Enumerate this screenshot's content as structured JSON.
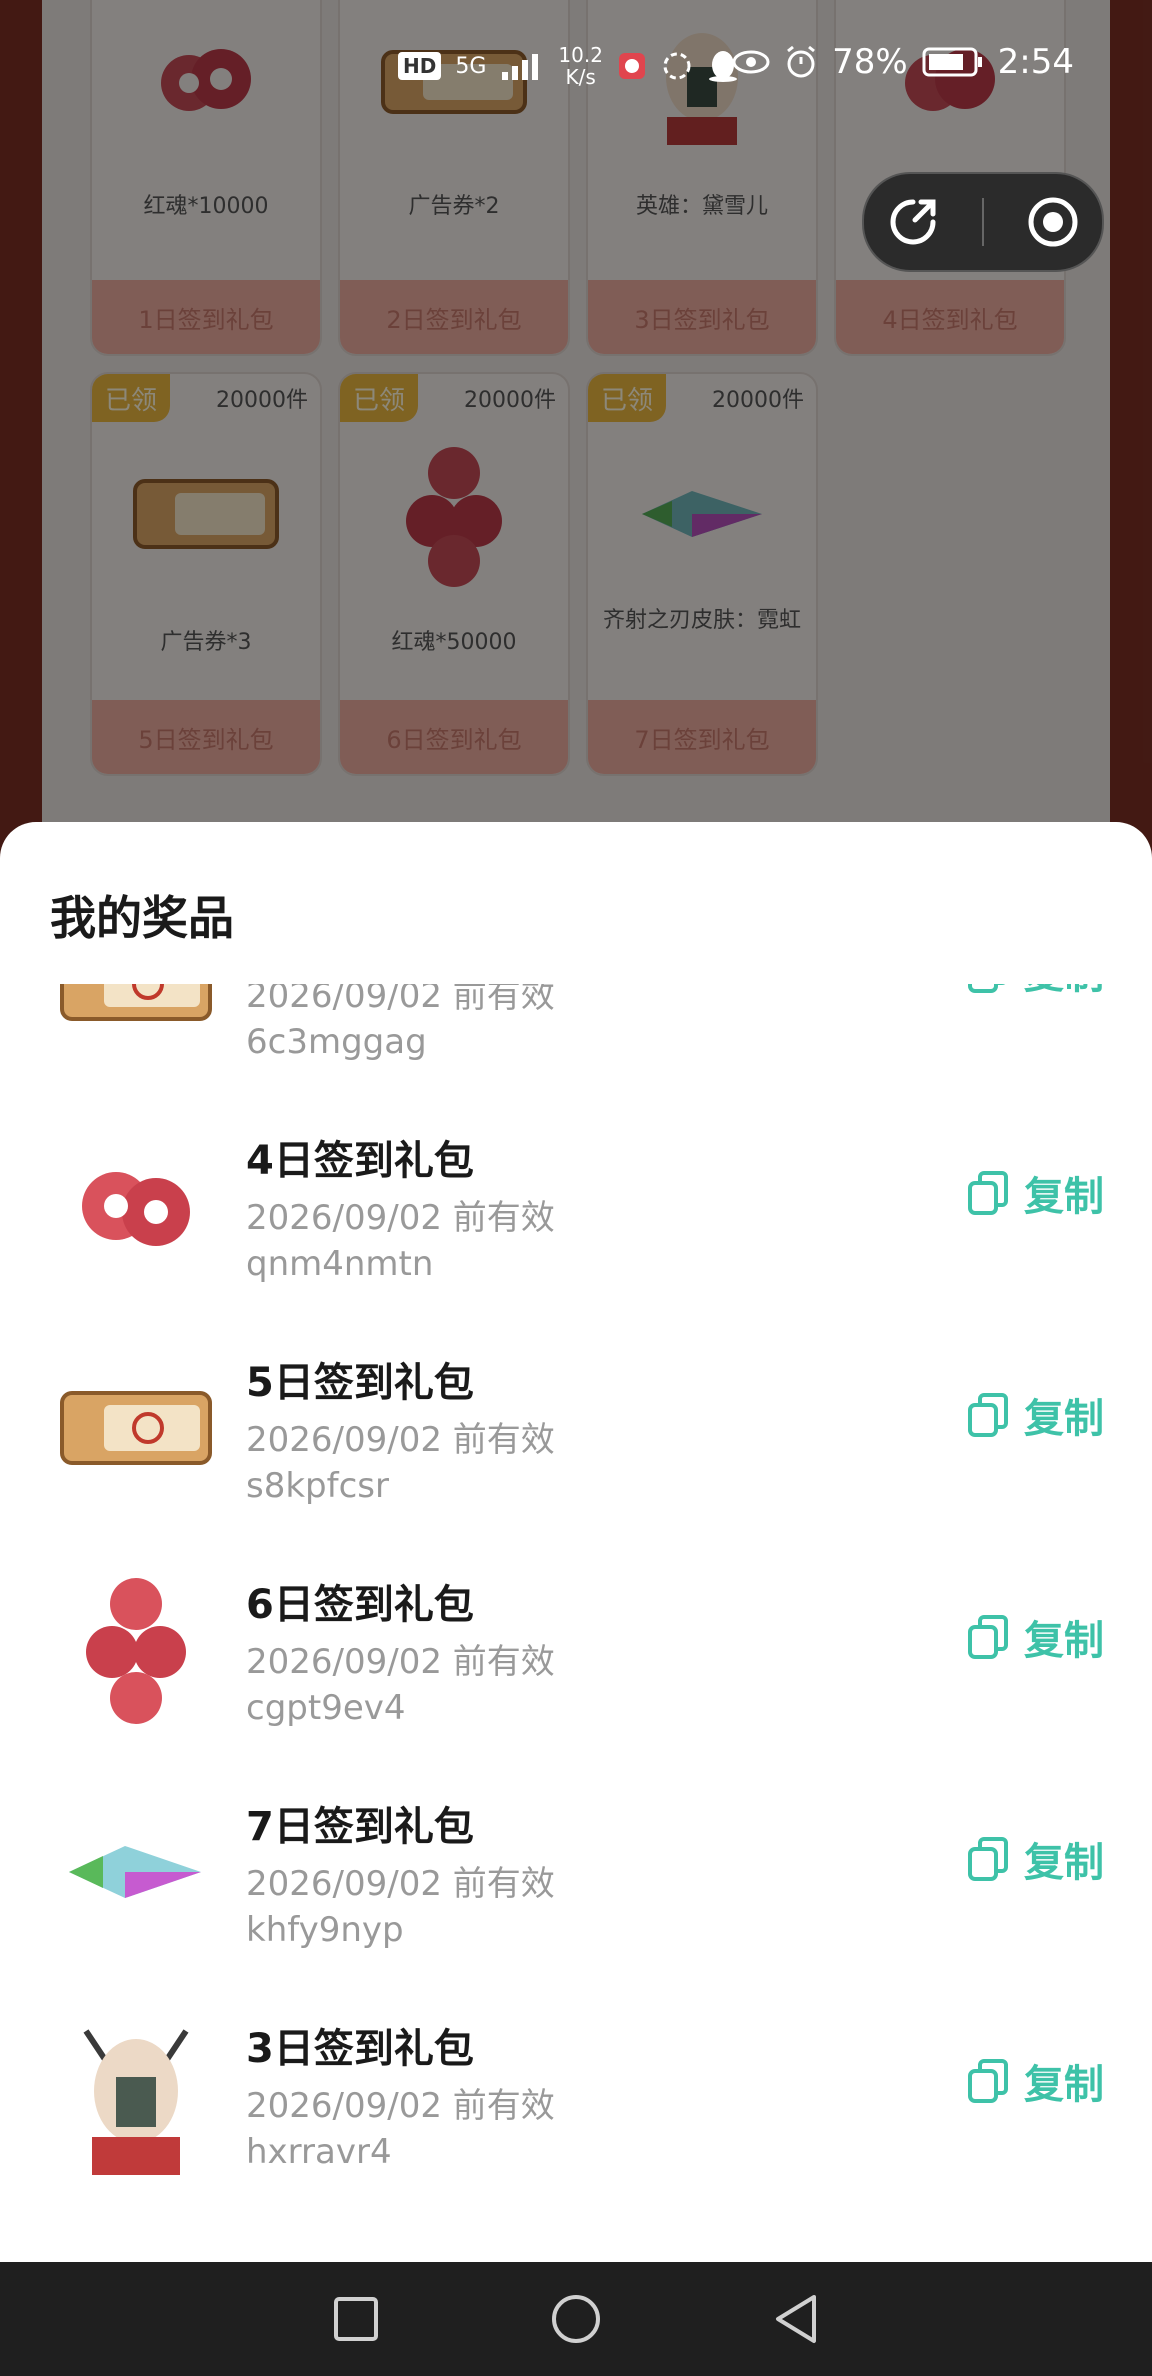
{
  "status_bar": {
    "hd": "HD",
    "network": "5G",
    "speed_value": "10.2",
    "speed_unit": "K/s",
    "battery": "78%",
    "time": "2:54"
  },
  "background_cards": [
    {
      "name": "红魂*10000",
      "footer": "1日签到礼包"
    },
    {
      "name": "广告券*2",
      "footer": "2日签到礼包"
    },
    {
      "name": "英雄：黛雪儿",
      "footer": "3日签到礼包"
    },
    {
      "name": "",
      "footer": "4日签到礼包"
    },
    {
      "badge": "已领",
      "count": "20000件",
      "name": "广告券*3",
      "footer": "5日签到礼包"
    },
    {
      "badge": "已领",
      "count": "20000件",
      "name": "红魂*50000",
      "footer": "6日签到礼包"
    },
    {
      "badge": "已领",
      "count": "20000件",
      "name": "齐射之刃皮肤：霓虹",
      "footer": "7日签到礼包"
    }
  ],
  "sheet": {
    "title": "我的奖品",
    "copy_label": "复制",
    "items": [
      {
        "title": "",
        "expiry": "2026/09/02 前有效",
        "code": "6c3mggag",
        "icon": "ticket-icon"
      },
      {
        "title": "4日签到礼包",
        "expiry": "2026/09/02 前有效",
        "code": "qnm4nmtn",
        "icon": "red-soul-icon"
      },
      {
        "title": "5日签到礼包",
        "expiry": "2026/09/02 前有效",
        "code": "s8kpfcsr",
        "icon": "ticket-icon"
      },
      {
        "title": "6日签到礼包",
        "expiry": "2026/09/02 前有效",
        "code": "cgpt9ev4",
        "icon": "red-soul-stack-icon"
      },
      {
        "title": "7日签到礼包",
        "expiry": "2026/09/02 前有效",
        "code": "khfy9nyp",
        "icon": "blade-skin-icon"
      },
      {
        "title": "3日签到礼包",
        "expiry": "2026/09/02 前有效",
        "code": "hxrravr4",
        "icon": "hero-portrait-icon"
      }
    ]
  },
  "colors": {
    "accent": "#3ec2a8",
    "badge": "#e8b53f",
    "card_footer": "#e9a99d",
    "frame": "#7a2f24"
  }
}
